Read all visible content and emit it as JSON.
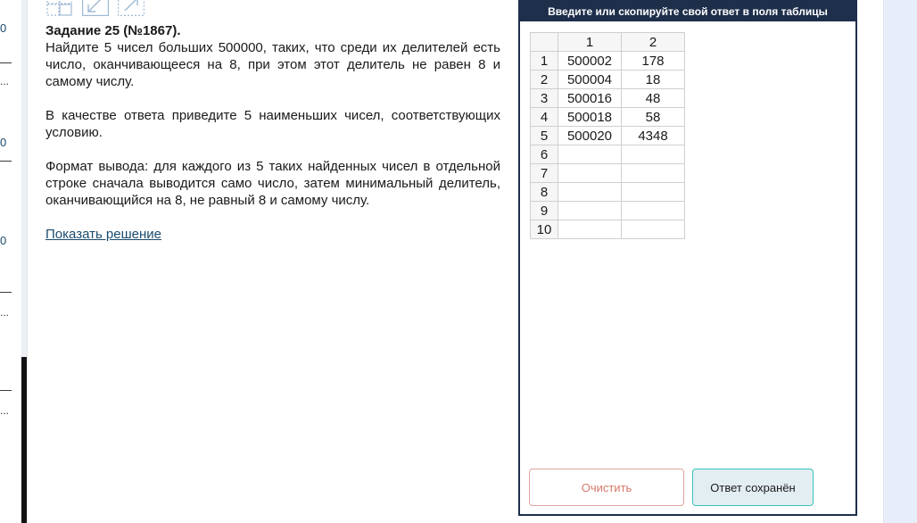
{
  "sidebar": {
    "marks": [
      "0",
      "0",
      "0"
    ],
    "ellipses": [
      "...",
      "...",
      "..."
    ]
  },
  "toolbar": {
    "icons": [
      "grid-icon",
      "shrink-icon",
      "expand-icon"
    ]
  },
  "task": {
    "title": "Задание 25 (№1867).",
    "paragraph1": "Найдите 5 чисел больших 500000, таких, что среди их делителей есть число, оканчивающееся на 8, при этом этот делитель не равен 8 и самому числу.",
    "paragraph2": "В качестве ответа приведите 5 наименьших чисел, соответствующих условию.",
    "paragraph3": "Формат вывода: для каждого из 5 таких найденных чисел в отдельной строке сначала выводится само число, затем минимальный делитель, оканчивающийся на 8, не равный 8 и самому числу.",
    "show_solution": "Показать решение"
  },
  "answer_panel": {
    "header": "Введите или скопируйте свой ответ в поля таблицы",
    "columns": [
      "1",
      "2"
    ],
    "rows": [
      {
        "n": "1",
        "c1": "500002",
        "c2": "178"
      },
      {
        "n": "2",
        "c1": "500004",
        "c2": "18"
      },
      {
        "n": "3",
        "c1": "500016",
        "c2": "48"
      },
      {
        "n": "4",
        "c1": "500018",
        "c2": "58"
      },
      {
        "n": "5",
        "c1": "500020",
        "c2": "4348"
      },
      {
        "n": "6",
        "c1": "",
        "c2": ""
      },
      {
        "n": "7",
        "c1": "",
        "c2": ""
      },
      {
        "n": "8",
        "c1": "",
        "c2": ""
      },
      {
        "n": "9",
        "c1": "",
        "c2": ""
      },
      {
        "n": "10",
        "c1": "",
        "c2": ""
      }
    ],
    "clear_button": "Очистить",
    "saved_button": "Ответ сохранён"
  },
  "colors": {
    "header_bg": "#1e2f4b",
    "link": "#1b4b6e",
    "clear_accent": "#d9786b",
    "saved_border": "#37c4b5",
    "saved_bg": "#e3eef3"
  }
}
